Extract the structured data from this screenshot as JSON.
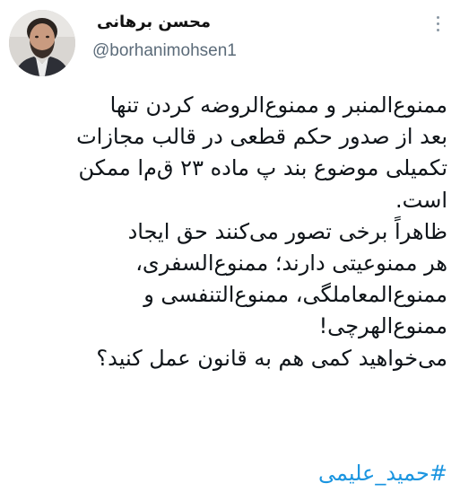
{
  "tweet": {
    "author": {
      "display_name": "محسن برهانی",
      "handle": "@borhanimohsen1",
      "avatar_icon": "profile-photo"
    },
    "more_icon": "vertical-ellipsis-icon",
    "body_lines": [
      "ممنوع‌المنبر و ممنوع‌الروضه کردن تنها",
      "بعد از صدور حکم قطعی در قالب مجازات",
      "تکمیلی موضوع بند پ ماده ۲۳ ق‌م‌ا ممکن",
      "است.",
      "ظاهراً برخی تصور می‌کنند حق ایجاد",
      "هر ممنوعیتی دارند؛ ممنوع‌السفری،",
      "ممنوع‌المعاملگی، ممنوع‌التنفسی و",
      "ممنوع‌الهرچی!",
      "می‌خواهید کمی هم به قانون عمل کنید؟"
    ],
    "hashtag": "#حمید_علیمی",
    "colors": {
      "text": "#0f1419",
      "handle": "#5b6b79",
      "link": "#1b95e0"
    }
  }
}
